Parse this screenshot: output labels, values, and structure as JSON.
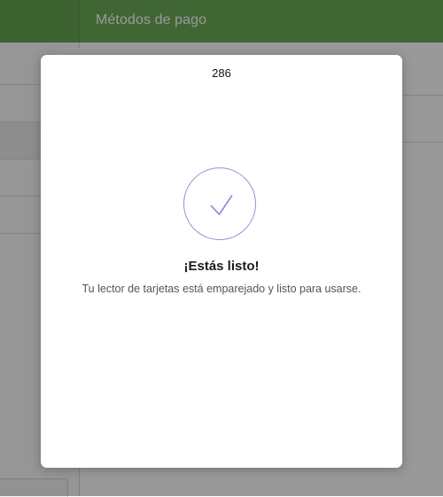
{
  "app_bar": {
    "title": "Métodos de pago",
    "color": "#6cab57"
  },
  "modal": {
    "number": "286",
    "icon": "check-circle-icon",
    "icon_color": "#9a8fd9",
    "title": "¡Estás listo!",
    "message": "Tu lector de tarjetas está emparejado y listo para usarse."
  }
}
